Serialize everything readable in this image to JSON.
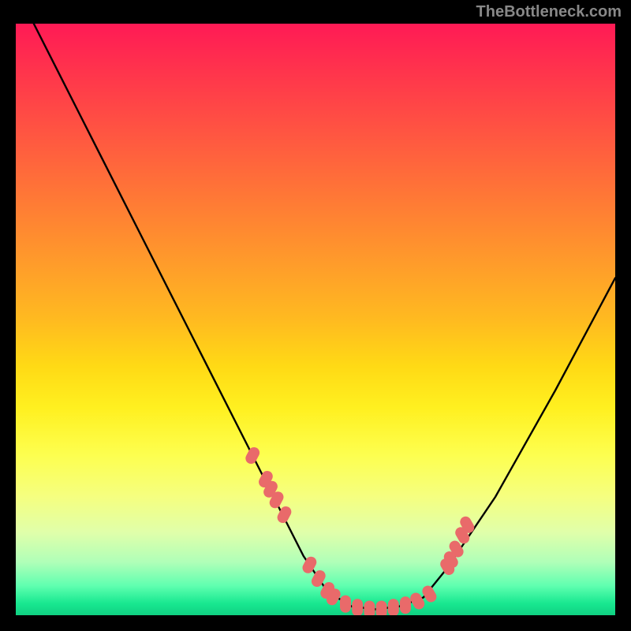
{
  "watermark": "TheBottleneck.com",
  "chart_data": {
    "type": "line",
    "title": "",
    "xlabel": "",
    "ylabel": "",
    "xlim": [
      0,
      100
    ],
    "ylim": [
      0,
      100
    ],
    "series": [
      {
        "name": "curve",
        "x": [
          3,
          10,
          20,
          30,
          38,
          44,
          48,
          52,
          56,
          60,
          64,
          68,
          72,
          80,
          90,
          100
        ],
        "y": [
          100,
          86,
          66,
          46,
          30,
          18,
          10,
          4,
          1.5,
          1,
          1.5,
          3,
          8,
          20,
          38,
          57
        ]
      }
    ],
    "highlight_points": {
      "name": "dots",
      "color": "#e96a6a",
      "x": [
        39.5,
        41.7,
        42.5,
        43.5,
        44.8,
        49,
        50.5,
        52,
        53,
        55,
        57,
        59,
        61,
        63,
        65,
        67,
        69,
        72,
        72.6,
        73.5,
        74.5,
        75.3
      ],
      "y": [
        27,
        23,
        21.3,
        19.5,
        17,
        8.5,
        6.2,
        4.2,
        3.1,
        1.9,
        1.3,
        1.0,
        1.0,
        1.3,
        1.7,
        2.4,
        3.6,
        8.2,
        9.4,
        11.2,
        13.5,
        15.3
      ]
    }
  }
}
